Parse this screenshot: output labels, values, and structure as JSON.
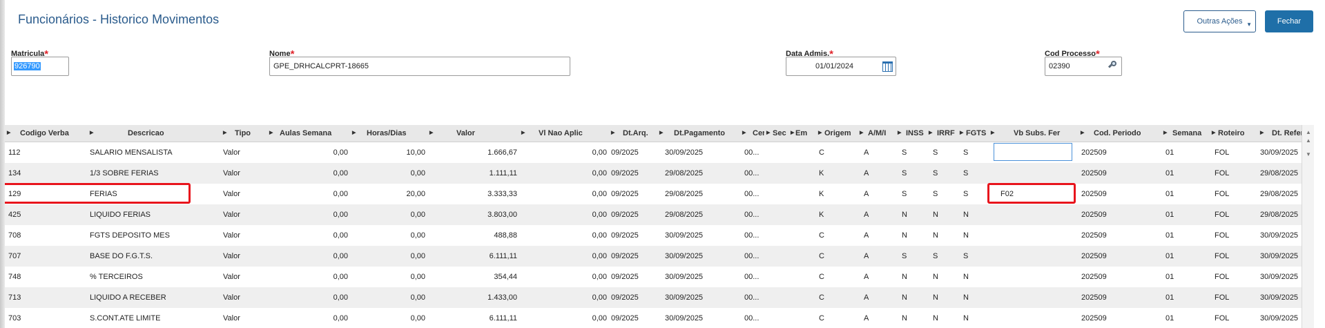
{
  "page": {
    "title": "Funcionários - Historico Movimentos"
  },
  "actions": {
    "outras_acoes": "Outras Ações",
    "fechar": "Fechar"
  },
  "fields": {
    "matricula": {
      "label": "Matricula",
      "value": "926790"
    },
    "nome": {
      "label": "Nome",
      "value": "GPE_DRHCALCPRT-18665"
    },
    "data_admis": {
      "label": "Data Admis.",
      "value": "01/01/2024"
    },
    "cod_processo": {
      "label": "Cod Processo",
      "value": "02390"
    }
  },
  "grid": {
    "columns": [
      "Codigo Verba",
      "Descricao",
      "Tipo",
      "Aulas Semana",
      "Horas/Dias",
      "Valor",
      "Vl Nao Aplic",
      "Dt.Arq.",
      "Dt.Pagamento",
      "Cer",
      "Sec",
      "Em",
      "Origem",
      "A/M/I",
      "INSS",
      "IRRF",
      "FGTS",
      "Vb Subs. Fer",
      "Cod. Periodo",
      "Semana",
      "Roteiro",
      "Dt. Refer."
    ],
    "rows": [
      [
        "112",
        "SALARIO MENSALISTA",
        "Valor",
        "0,00",
        "10,00",
        "1.666,67",
        "0,00",
        "09/2025",
        "30/09/2025",
        "00...",
        "",
        "",
        "C",
        "A",
        "S",
        "S",
        "S",
        "",
        "202509",
        "01",
        "FOL",
        "30/09/2025"
      ],
      [
        "134",
        "1/3 SOBRE FERIAS",
        "Valor",
        "0,00",
        "0,00",
        "1.111,11",
        "0,00",
        "09/2025",
        "29/08/2025",
        "00...",
        "",
        "",
        "K",
        "A",
        "S",
        "S",
        "S",
        "",
        "202509",
        "01",
        "FOL",
        "29/08/2025"
      ],
      [
        "129",
        "FERIAS",
        "Valor",
        "0,00",
        "20,00",
        "3.333,33",
        "0,00",
        "09/2025",
        "29/08/2025",
        "00...",
        "",
        "",
        "K",
        "A",
        "S",
        "S",
        "S",
        "F02",
        "202509",
        "01",
        "FOL",
        "29/08/2025"
      ],
      [
        "425",
        "LIQUIDO FERIAS",
        "Valor",
        "0,00",
        "0,00",
        "3.803,00",
        "0,00",
        "09/2025",
        "29/08/2025",
        "00...",
        "",
        "",
        "K",
        "A",
        "N",
        "N",
        "N",
        "",
        "202509",
        "01",
        "FOL",
        "29/08/2025"
      ],
      [
        "708",
        "FGTS DEPOSITO MES",
        "Valor",
        "0,00",
        "0,00",
        "488,88",
        "0,00",
        "09/2025",
        "30/09/2025",
        "00...",
        "",
        "",
        "C",
        "A",
        "N",
        "N",
        "N",
        "",
        "202509",
        "01",
        "FOL",
        "30/09/2025"
      ],
      [
        "707",
        "BASE DO F.G.T.S.",
        "Valor",
        "0,00",
        "0,00",
        "6.111,11",
        "0,00",
        "09/2025",
        "30/09/2025",
        "00...",
        "",
        "",
        "C",
        "A",
        "S",
        "S",
        "S",
        "",
        "202509",
        "01",
        "FOL",
        "30/09/2025"
      ],
      [
        "748",
        "% TERCEIROS",
        "Valor",
        "0,00",
        "0,00",
        "354,44",
        "0,00",
        "09/2025",
        "30/09/2025",
        "00...",
        "",
        "",
        "C",
        "A",
        "N",
        "N",
        "N",
        "",
        "202509",
        "01",
        "FOL",
        "30/09/2025"
      ],
      [
        "713",
        "LIQUIDO A RECEBER",
        "Valor",
        "0,00",
        "0,00",
        "1.433,00",
        "0,00",
        "09/2025",
        "30/09/2025",
        "00...",
        "",
        "",
        "C",
        "A",
        "N",
        "N",
        "N",
        "",
        "202509",
        "01",
        "FOL",
        "30/09/2025"
      ],
      [
        "703",
        "S.CONT.ATE LIMITE",
        "Valor",
        "0,00",
        "0,00",
        "6.111,11",
        "0,00",
        "09/2025",
        "30/09/2025",
        "00...",
        "",
        "",
        "C",
        "A",
        "N",
        "N",
        "N",
        "",
        "202509",
        "01",
        "FOL",
        "30/09/2025"
      ]
    ]
  },
  "colors": {
    "title": "#2a5b8c",
    "primary_button": "#1f6fa8",
    "highlight": "#e8141c",
    "required": "#e0262d"
  }
}
